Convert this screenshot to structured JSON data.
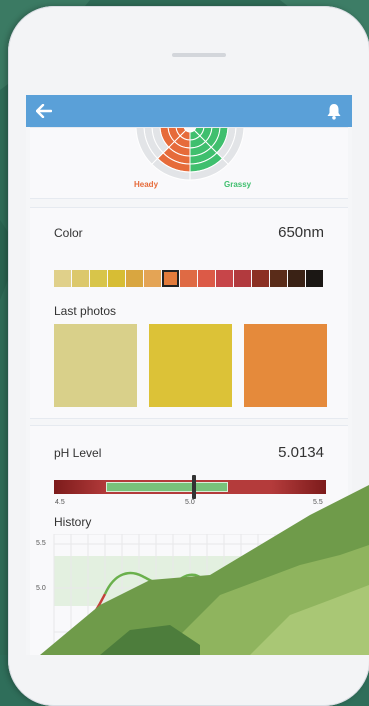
{
  "app": {
    "back_icon": "arrow-left-icon",
    "bell_icon": "bell-icon",
    "accent": "#5aa0d8"
  },
  "flavor_wheel": {
    "labels": [
      "Heady",
      "Grassy"
    ],
    "colors": {
      "heady": "#e66b3a",
      "grassy": "#3fbf6e"
    }
  },
  "color_section": {
    "title": "Color",
    "value": "650nm",
    "swatches": [
      "#e0d08a",
      "#dcc86b",
      "#d8c54a",
      "#d7bd34",
      "#d9a640",
      "#e4a455",
      "#e27b3b",
      "#df6a44",
      "#dc5a47",
      "#c74549",
      "#b23a3e",
      "#8c3023",
      "#5a2c19",
      "#3a2215",
      "#1b1714"
    ],
    "selected_index": 6,
    "photos_title": "Last photos",
    "photos": [
      "#d9d08a",
      "#dcc237",
      "#e58a3b"
    ]
  },
  "ph_section": {
    "title": "pH Level",
    "value": "5.0134",
    "scale": {
      "min_label": "4.5",
      "mid_label": "5.0",
      "max_label": "5.5",
      "min": 4.5,
      "max": 5.5
    },
    "ideal_range": [
      4.69,
      5.14
    ],
    "current": 5.0134,
    "history_title": "History",
    "history_axis": [
      "5.5",
      "5.0"
    ]
  }
}
